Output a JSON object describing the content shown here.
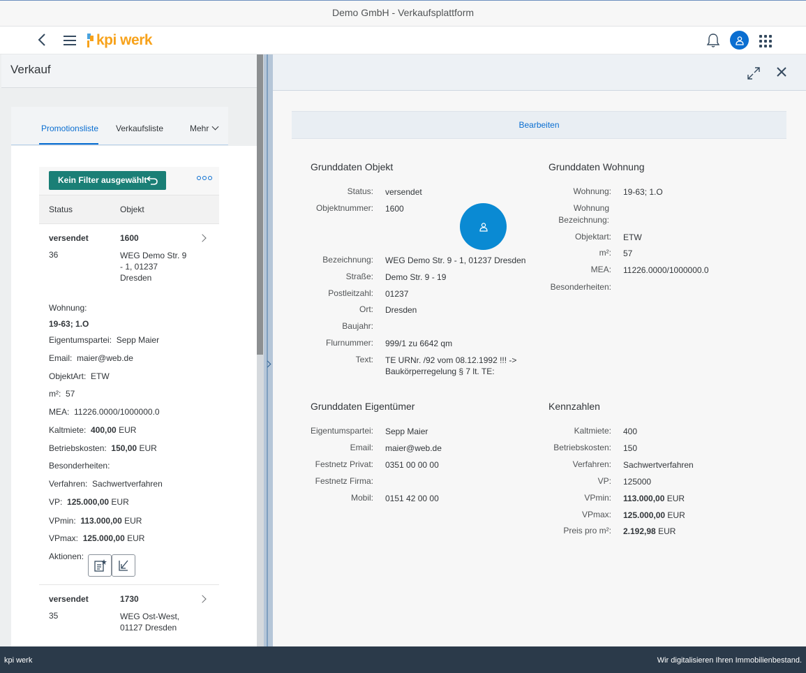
{
  "window": {
    "title": "Demo GmbH - Verkaufsplattform"
  },
  "shell": {
    "logo_text": "kpi werk"
  },
  "master": {
    "title": "Verkauf",
    "tabs": [
      "Promotionsliste",
      "Verkaufsliste",
      "Mehr"
    ],
    "filter_button": "Kein Filter ausgewählt",
    "columns": [
      "Status",
      "Objekt"
    ],
    "items": [
      {
        "status": "versendet",
        "objekt": "1600",
        "nummer": "36",
        "adresse": "WEG Demo Str. 9 - 1, 01237 Dresden",
        "wohnung_label": "Wohnung:",
        "wohnung": "19-63; 1.O",
        "eigentum_label": "Eigentumspartei:",
        "eigentum": "Sepp Maier",
        "email_label": "Email:",
        "email": "maier@web.de",
        "objektart_label": "ObjektArt:",
        "objektart": "ETW",
        "m2_label": "m²:",
        "m2": "57",
        "mea_label": "MEA:",
        "mea": "11226.0000/1000000.0",
        "kaltmiete_label": "Kaltmiete:",
        "kaltmiete": "400,00",
        "kaltmiete_unit": "EUR",
        "betrieb_label": "Betriebskosten:",
        "betrieb": "150,00",
        "betrieb_unit": "EUR",
        "besonder_label": "Besonderheiten:",
        "verfahren_label": "Verfahren:",
        "verfahren": "Sachwertverfahren",
        "vp_label": "VP:",
        "vp": "125.000,00",
        "vp_unit": "EUR",
        "vpmin_label": "VPmin:",
        "vpmin": "113.000,00",
        "vpmin_unit": "EUR",
        "vpmax_label": "VPmax:",
        "vpmax": "125.000,00",
        "vpmax_unit": "EUR",
        "aktionen_label": "Aktionen:"
      },
      {
        "status": "versendet",
        "objekt": "1730",
        "nummer": "35",
        "adresse": "WEG Ost-West, 01127 Dresden"
      }
    ]
  },
  "detail": {
    "edit_button": "Bearbeiten",
    "objekt": {
      "title": "Grunddaten Objekt",
      "fields": [
        {
          "label": "Status:",
          "value": "versendet"
        },
        {
          "label": "Objektnummer:",
          "value": "1600"
        },
        {
          "label": "Bezeichnung:",
          "value": "WEG Demo Str. 9 - 1, 01237 Dresden"
        },
        {
          "label": "Straße:",
          "value": "Demo Str. 9 - 19"
        },
        {
          "label": "Postleitzahl:",
          "value": "01237"
        },
        {
          "label": "Ort:",
          "value": "Dresden"
        },
        {
          "label": "Baujahr:",
          "value": ""
        },
        {
          "label": "Flurnummer:",
          "value": "999/1 zu 6642 qm"
        },
        {
          "label": "Text:",
          "value": "TE URNr. /92 vom 08.12.1992 !!! -> Baukörperregelung § 7 lt. TE:"
        }
      ]
    },
    "wohnung": {
      "title": "Grunddaten Wohnung",
      "fields": [
        {
          "label": "Wohnung:",
          "value": "19-63; 1.O"
        },
        {
          "label": "Wohnung Bezeichnung:",
          "value": ""
        },
        {
          "label": "Objektart:",
          "value": "ETW"
        },
        {
          "label": "m²:",
          "value": "57"
        },
        {
          "label": "MEA:",
          "value": "11226.0000/1000000.0"
        },
        {
          "label": "Besonderheiten:",
          "value": ""
        }
      ]
    },
    "eigentuemer": {
      "title": "Grunddaten Eigentümer",
      "fields": [
        {
          "label": "Eigentumspartei:",
          "value": "Sepp Maier"
        },
        {
          "label": "Email:",
          "value": "maier@web.de"
        },
        {
          "label": "Festnetz Privat:",
          "value": "0351 00 00 00"
        },
        {
          "label": "Festnetz Firma:",
          "value": ""
        },
        {
          "label": "Mobil:",
          "value": "0151 42 00 00"
        }
      ]
    },
    "kennzahlen": {
      "title": "Kennzahlen",
      "fields": [
        {
          "label": "Kaltmiete:",
          "value": "400"
        },
        {
          "label": "Betriebskosten:",
          "value": "150"
        },
        {
          "label": "Verfahren:",
          "value": "Sachwertverfahren"
        },
        {
          "label": "VP:",
          "value": "125000"
        },
        {
          "label": "VPmin:",
          "value": "113.000,00",
          "unit": "EUR"
        },
        {
          "label": "VPmax:",
          "value": "125.000,00",
          "unit": "EUR"
        },
        {
          "label": "Preis pro m²:",
          "value": "2.192,98",
          "unit": "EUR"
        }
      ]
    }
  },
  "footer": {
    "left": "kpi werk",
    "right": "Wir digitalisieren Ihren Immobilienbestand."
  }
}
